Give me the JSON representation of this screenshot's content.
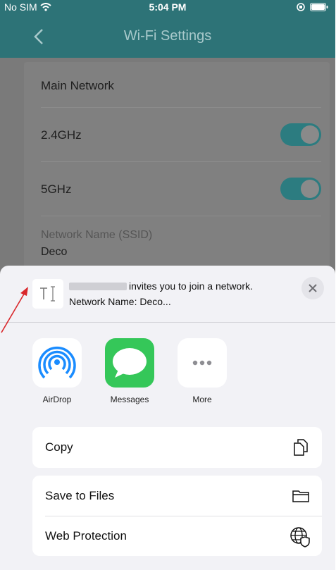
{
  "status_bar": {
    "carrier": "No SIM",
    "time": "5:04 PM"
  },
  "nav": {
    "title": "Wi-Fi Settings"
  },
  "settings": {
    "section": "Main Network",
    "band_24": {
      "label": "2.4GHz",
      "enabled": true
    },
    "band_5": {
      "label": "5GHz",
      "enabled": true
    },
    "ssid_label": "Network Name (SSID)",
    "ssid_value": "Deco"
  },
  "share_sheet": {
    "message_line1": "invites you to join a network.",
    "message_line2": "Network Name: Deco...",
    "apps": [
      {
        "name": "AirDrop",
        "icon": "airdrop-icon"
      },
      {
        "name": "Messages",
        "icon": "messages-icon"
      },
      {
        "name": "More",
        "icon": "more-icon"
      }
    ],
    "actions": [
      {
        "label": "Copy",
        "icon": "copy-icon"
      },
      {
        "label": "Save to Files",
        "icon": "folder-icon"
      },
      {
        "label": "Web Protection",
        "icon": "globe-shield-icon"
      }
    ]
  },
  "colors": {
    "brand": "#2d7377",
    "toggle_on": "#2c7c80",
    "messages_green": "#35c759",
    "airdrop_blue": "#1a8cff"
  }
}
